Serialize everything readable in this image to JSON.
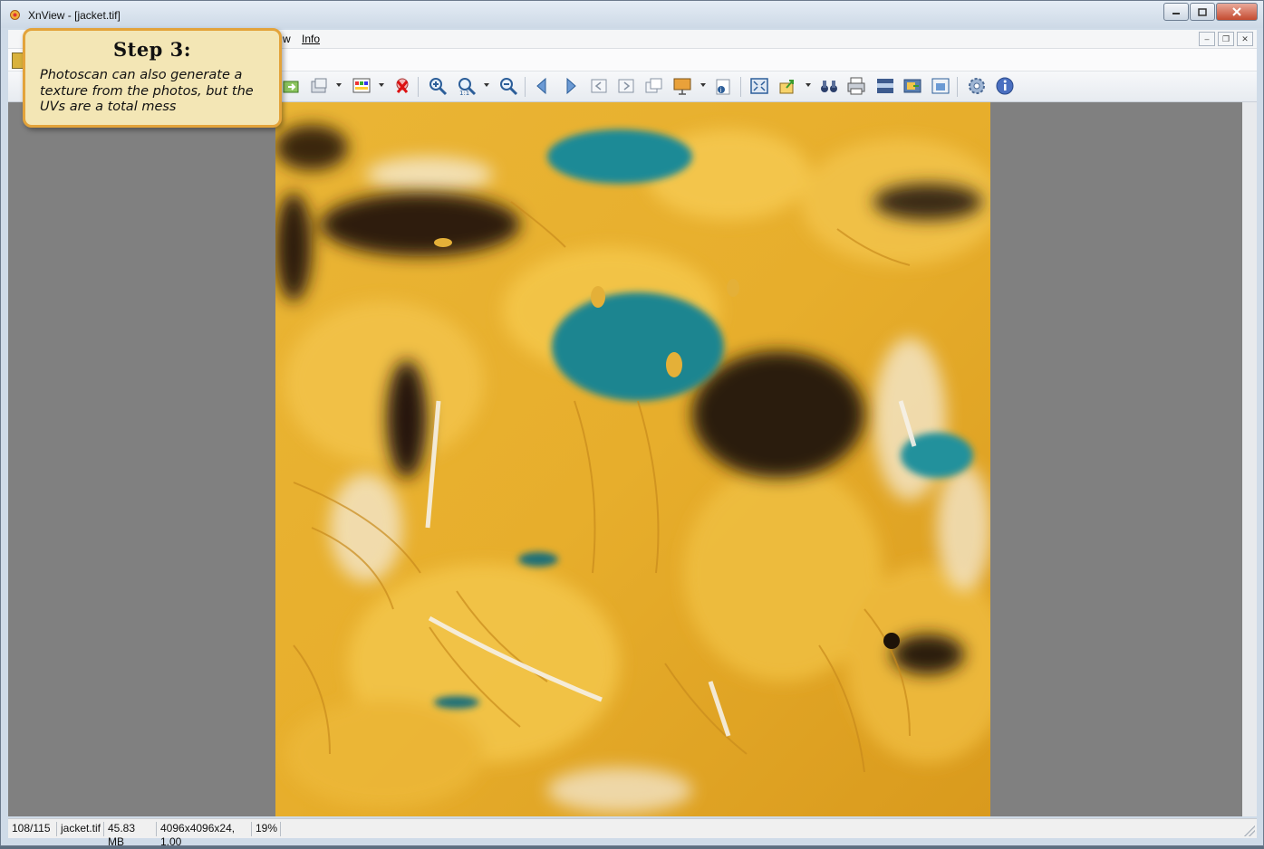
{
  "window": {
    "title": "XnView - [jacket.tif]"
  },
  "menu": {
    "partial_item": "w",
    "info": "Info"
  },
  "callout": {
    "title": "Step 3:",
    "body": "Photoscan can also generate a texture from the photos, but the UVs are a total mess"
  },
  "toolbar": {
    "icons": [
      "open-icon",
      "acquire-icon",
      "adjust-icon",
      "delete-icon",
      "zoom-in-icon",
      "zoom-icon",
      "zoom-out-icon",
      "previous-icon",
      "next-icon",
      "first-icon",
      "last-icon",
      "slideshow-icon",
      "properties-icon",
      "fit-icon",
      "export-icon",
      "compare-icon",
      "print-icon",
      "filmstrip-icon",
      "capture-icon",
      "screenshot-icon",
      "settings-icon",
      "about-icon"
    ]
  },
  "image": {
    "description_colors": {
      "base": "#e3ab2c",
      "dark": "#2a1a0c",
      "teal": "#1f8a96"
    }
  },
  "status": {
    "index": "108/115",
    "filename": "jacket.tif",
    "size": "45.83 MB",
    "dimensions": "4096x4096x24, 1.00",
    "zoom": "19%"
  }
}
